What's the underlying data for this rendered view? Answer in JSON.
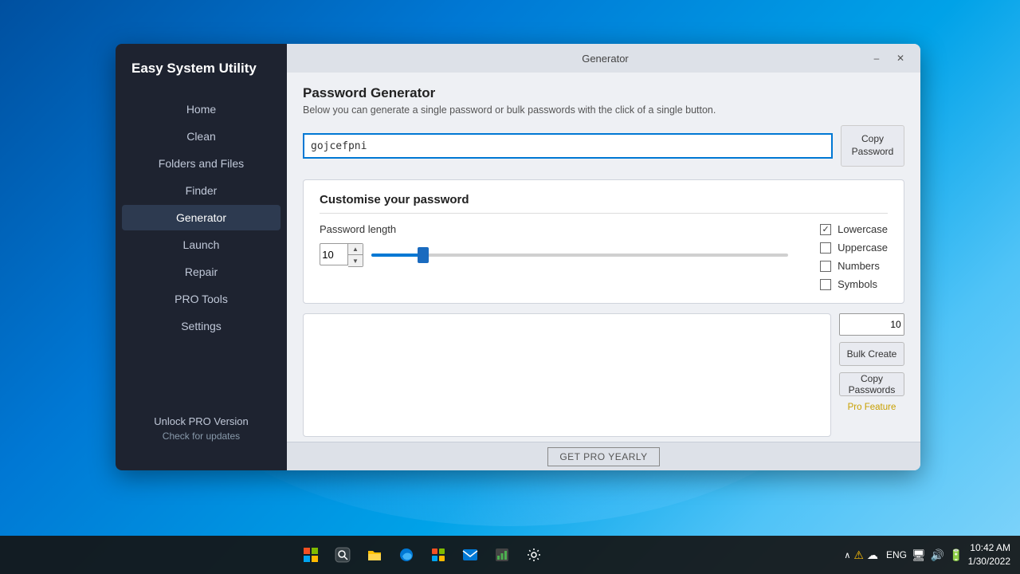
{
  "app": {
    "title": "Easy System Utility",
    "window_title": "Generator"
  },
  "sidebar": {
    "items": [
      {
        "label": "Home",
        "active": false
      },
      {
        "label": "Clean",
        "active": false
      },
      {
        "label": "Folders and Files",
        "active": false
      },
      {
        "label": "Finder",
        "active": false
      },
      {
        "label": "Generator",
        "active": true
      },
      {
        "label": "Launch",
        "active": false
      },
      {
        "label": "Repair",
        "active": false
      },
      {
        "label": "PRO Tools",
        "active": false
      },
      {
        "label": "Settings",
        "active": false
      }
    ],
    "unlock_label": "Unlock PRO Version",
    "check_updates_label": "Check for updates"
  },
  "main": {
    "section_title": "Password Generator",
    "section_subtitle": "Below you can generate a single password or bulk passwords with the click of a single button.",
    "password_value": "gojcefpni",
    "copy_password_label": "Copy\nPassword",
    "customise": {
      "title": "Customise your password",
      "password_length_label": "Password length",
      "length_value": "10",
      "checkboxes": [
        {
          "label": "Lowercase",
          "checked": true
        },
        {
          "label": "Uppercase",
          "checked": false
        },
        {
          "label": "Numbers",
          "checked": false
        },
        {
          "label": "Symbols",
          "checked": false
        }
      ]
    },
    "bulk": {
      "count_value": "10",
      "bulk_create_label": "Bulk Create",
      "copy_passwords_label": "Copy\nPasswords",
      "pro_feature_label": "Pro Feature"
    },
    "bottom_btn_label": "GET PRO YEARLY"
  },
  "titlebar": {
    "minimize_label": "–",
    "close_label": "✕"
  },
  "taskbar": {
    "time": "10:42 AM",
    "date": "1/30/2022",
    "lang": "ENG",
    "icons": [
      "⊞",
      "❑",
      "🌐",
      "📁",
      "⊞",
      "✉",
      "🖥",
      "⚙"
    ]
  }
}
